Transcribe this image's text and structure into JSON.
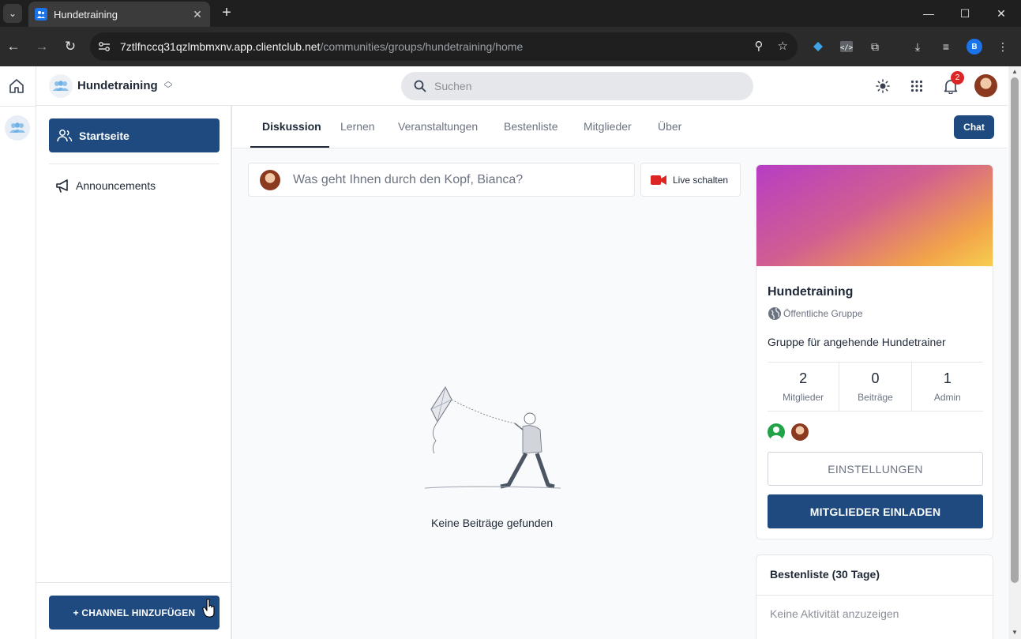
{
  "browser": {
    "tab_title": "Hundetraining",
    "url_host": "7ztlfnccq31qzlmbmxnv.app.clientclub.net",
    "url_path": "/communities/groups/hundetraining/home",
    "profile_initial": "B"
  },
  "header": {
    "group_name": "Hundetraining",
    "search_placeholder": "Suchen",
    "notification_count": "2"
  },
  "sidebar": {
    "home_label": "Startseite",
    "channels": [
      {
        "label": "Announcements",
        "icon": "megaphone-icon"
      }
    ],
    "add_channel_label": "+ CHANNEL HINZUFÜGEN"
  },
  "tabs": [
    {
      "label": "Diskussion",
      "active": true
    },
    {
      "label": "Lernen"
    },
    {
      "label": "Veranstaltungen"
    },
    {
      "label": "Bestenliste"
    },
    {
      "label": "Mitglieder"
    },
    {
      "label": "Über"
    }
  ],
  "chat_label": "Chat",
  "composer": {
    "placeholder": "Was geht Ihnen durch den Kopf, Bianca?",
    "live_label": "Live schalten"
  },
  "empty_state": "Keine Beiträge gefunden",
  "group_card": {
    "title": "Hundetraining",
    "type": "Öffentliche Gruppe",
    "description": "Gruppe für angehende Hundetrainer",
    "stats": [
      {
        "value": "2",
        "label": "Mitglieder"
      },
      {
        "value": "0",
        "label": "Beiträge"
      },
      {
        "value": "1",
        "label": "Admin"
      }
    ],
    "settings_label": "EINSTELLUNGEN",
    "invite_label": "MITGLIEDER EINLADEN"
  },
  "leaderboard": {
    "title": "Bestenliste (30 Tage)",
    "empty": "Keine Aktivität anzuzeigen"
  },
  "colors": {
    "primary": "#1e4a80",
    "badge": "#dc2626"
  }
}
